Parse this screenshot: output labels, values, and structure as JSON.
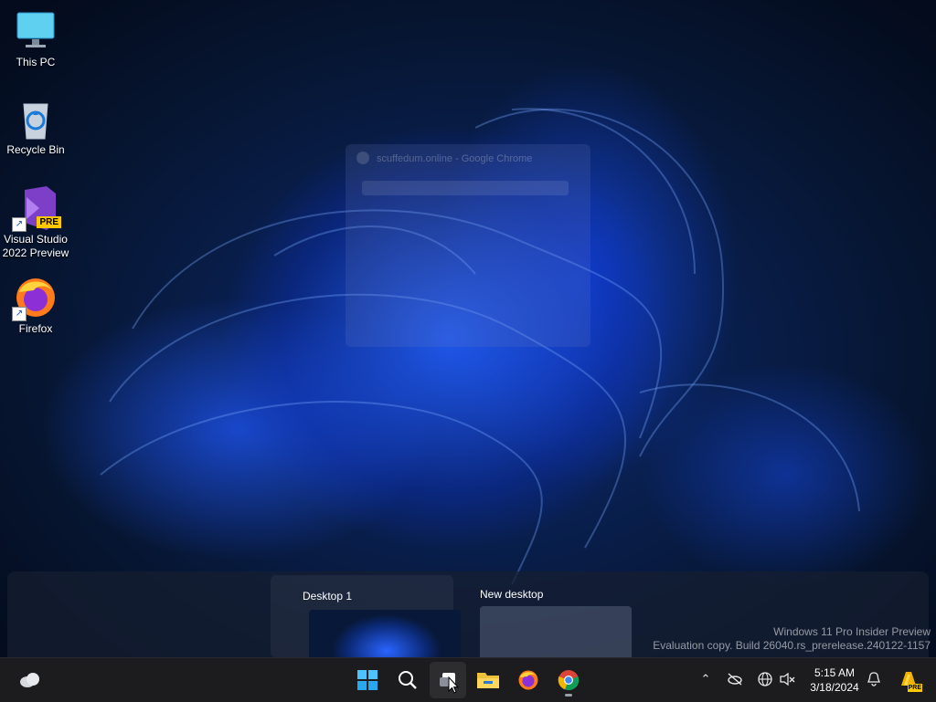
{
  "desktop_icons": [
    {
      "label": "This PC",
      "icon": "monitor-icon"
    },
    {
      "label": "Recycle Bin",
      "icon": "recycle-bin-icon"
    },
    {
      "label": "Visual Studio 2022 Preview",
      "icon": "visual-studio-preview-icon",
      "badge": "PRE"
    },
    {
      "label": "Firefox",
      "icon": "firefox-icon"
    }
  ],
  "ghost_window": {
    "title": "scuffedum.online - Google Chrome"
  },
  "task_view": {
    "desktops": [
      {
        "name": "Desktop 1"
      },
      {
        "name": "New desktop"
      }
    ]
  },
  "watermark": {
    "line1": "Windows 11 Pro Insider Preview",
    "line2": "Evaluation copy. Build 26040.rs_prerelease.240122-1157"
  },
  "taskbar": {
    "weather_icon": "weather-cloud-icon",
    "apps": [
      "start-icon",
      "search-icon",
      "task-view-icon",
      "file-explorer-icon",
      "firefox-icon",
      "chrome-icon"
    ],
    "tray": {
      "time": "5:15 AM",
      "date": "3/18/2024",
      "copilot_badge": "PRE"
    }
  },
  "colors": {
    "accent": "#0078d4",
    "taskbar": "#1c1c1f",
    "wallpaper_blue": "#1f5cff"
  }
}
